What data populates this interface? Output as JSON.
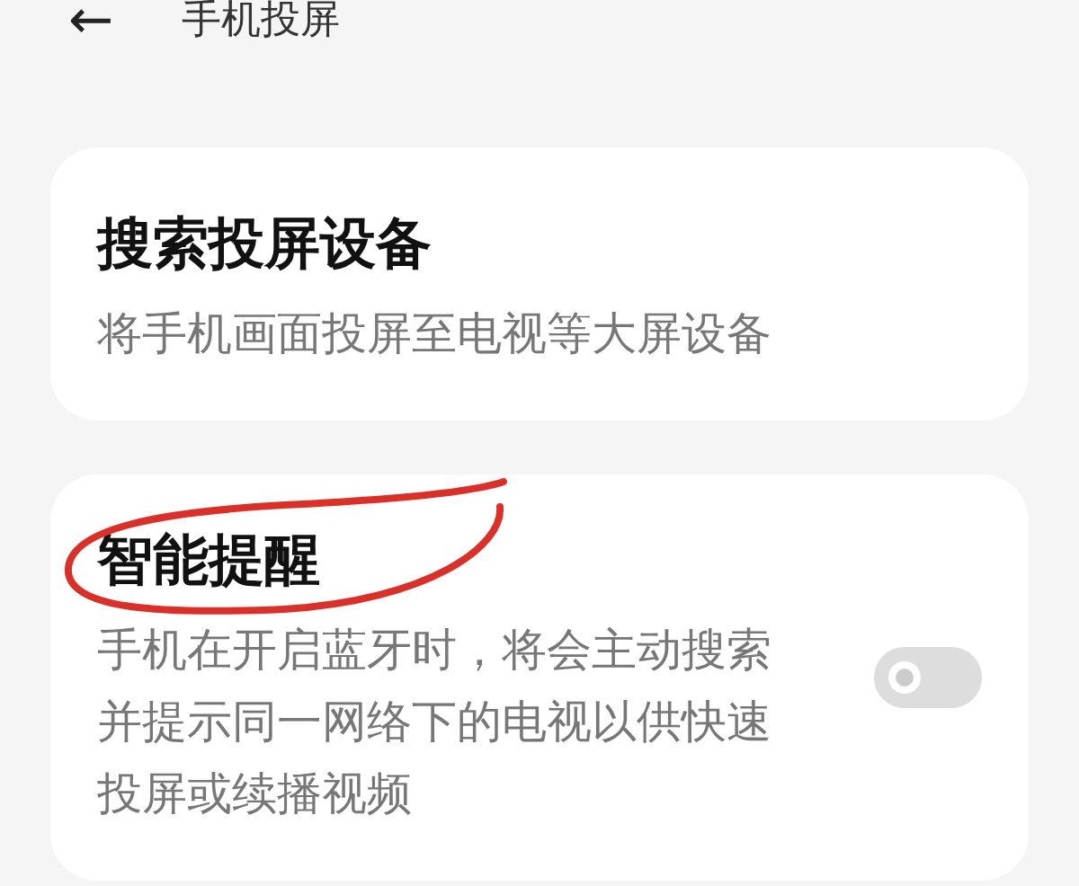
{
  "header": {
    "back_icon": "←",
    "title": "手机投屏"
  },
  "cards": [
    {
      "title": "搜索投屏设备",
      "description": "将手机画面投屏至电视等大屏设备"
    },
    {
      "title": "智能提醒",
      "description": "手机在开启蓝牙时，将会主动搜索并提示同一网络下的电视以供快速投屏或续播视频",
      "toggle": {
        "on": false
      }
    }
  ]
}
